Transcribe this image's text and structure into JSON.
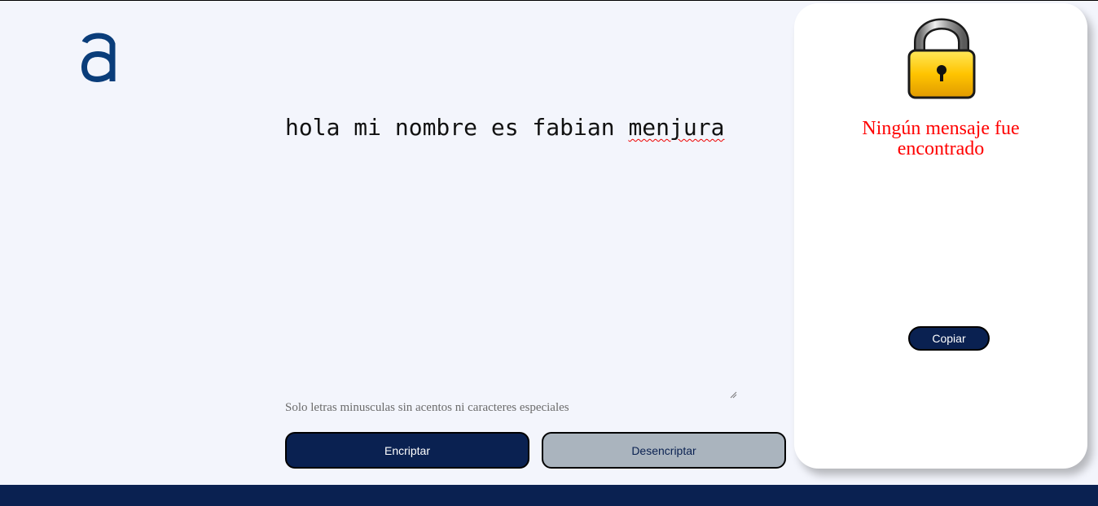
{
  "logo": {
    "icon": "alura-logo-icon",
    "color": "#0a3d7a"
  },
  "input": {
    "text_plain": "hola mi nombre es fabian ",
    "text_misspelled": "menjura"
  },
  "hint": "Solo letras minusculas sin acentos ni caracteres especiales",
  "buttons": {
    "encrypt": "Encriptar",
    "decrypt": "Desencriptar"
  },
  "output": {
    "icon": "padlock-icon",
    "message_line1": "Ningún mensaje fue",
    "message_line2": "encontrado",
    "copy": "Copiar"
  },
  "colors": {
    "primary": "#0a2151",
    "secondary": "#aab4be",
    "message": "#ff0000",
    "background": "#f3f5fc"
  }
}
